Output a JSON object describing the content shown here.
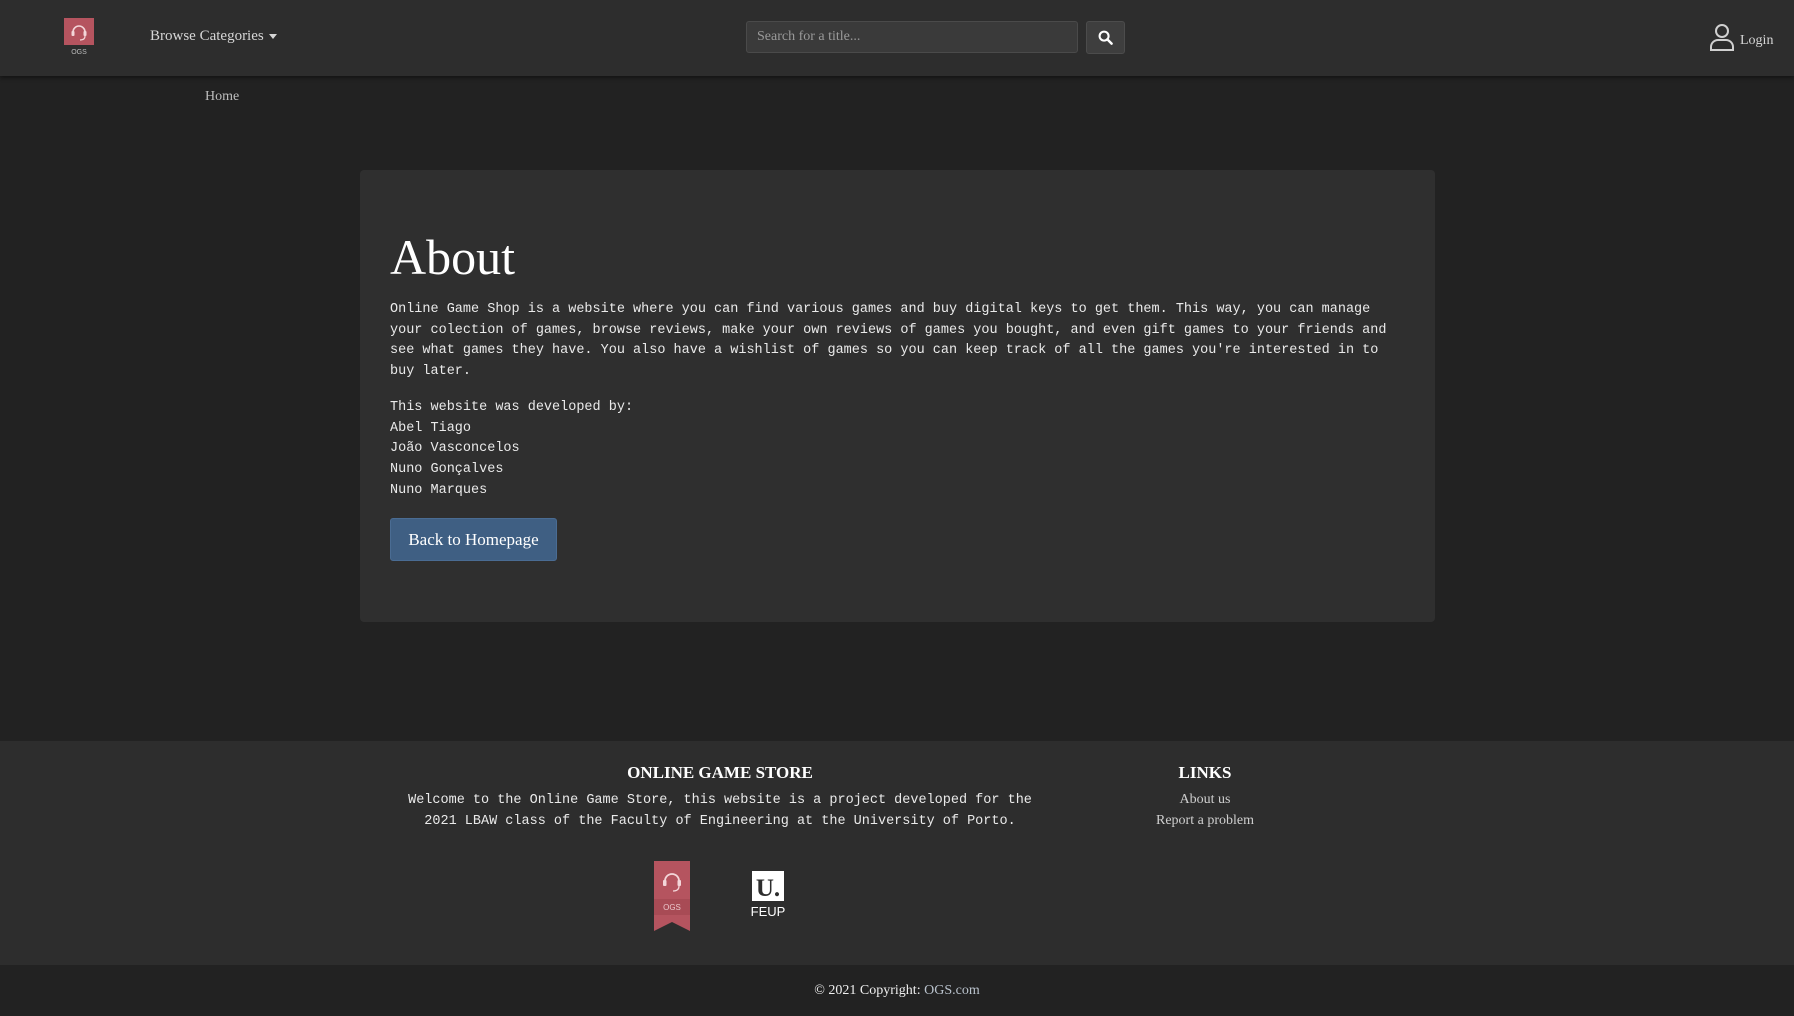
{
  "navbar": {
    "logo_text": "OGS",
    "browse_label": "Browse Categories",
    "search_placeholder": "Search for a title...",
    "search_icon": "search-icon",
    "login_label": "Login",
    "login_icon": "user-icon"
  },
  "breadcrumb": {
    "home": "Home"
  },
  "about": {
    "title": "About",
    "description": "Online Game Shop is a website where you can find various games and buy digital keys to get them. This way, you can manage your colection of games, browse reviews, make your own reviews of games you bought, and even gift games to your friends and see what games they have. You also have a wishlist of games so you can keep track of all the games you're interested in to buy later.",
    "developed_by": "This website was developed by:",
    "developers": [
      "Abel Tiago",
      "João Vasconcelos",
      "Nuno Gonçalves",
      "Nuno Marques"
    ],
    "back_button": "Back to Homepage"
  },
  "footer": {
    "about_title": "ONLINE GAME STORE",
    "about_line1": "Welcome to the Online Game Store, this website is a project developed for the",
    "about_line2": "2021 LBAW class of the Faculty of Engineering at the University of Porto.",
    "links_title": "LINKS",
    "links": [
      "About us",
      "Report a problem"
    ],
    "ogs_logo_text": "OGS",
    "feup_logo_mark": "U.",
    "feup_logo_text": "FEUP"
  },
  "copyright": {
    "prefix": "© 2021 Copyright:",
    "link": "OGS.com"
  },
  "colors": {
    "background": "#222222",
    "navbar": "#2d2d2d",
    "card": "#2f2f2f",
    "primary_button": "#3f5f83",
    "logo_accent": "#b5545f"
  }
}
